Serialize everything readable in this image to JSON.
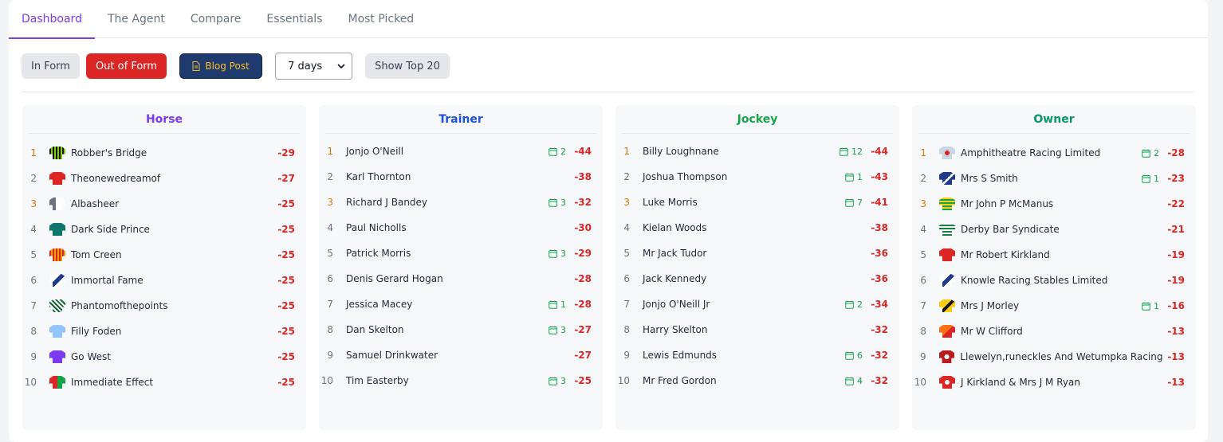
{
  "tabs": [
    "Dashboard",
    "The Agent",
    "Compare",
    "Essentials",
    "Most Picked"
  ],
  "toolbar": {
    "in_form": "In Form",
    "out_of_form": "Out of Form",
    "blog_post": "Blog Post",
    "days": "7 days",
    "show_top": "Show Top 20"
  },
  "colors": {
    "horse": "#7c3aed",
    "trainer": "#1d4ed8",
    "jockey": "#16a34a",
    "owner": "#059669",
    "negative": "#dc2626",
    "gold_rank": "#d97706"
  },
  "horse": {
    "title": "Horse",
    "rows": [
      {
        "rank": "1",
        "name": "Robber's Bridge",
        "value": "-29"
      },
      {
        "rank": "2",
        "name": "Theonewedreamof",
        "value": "-27"
      },
      {
        "rank": "3",
        "name": "Albasheer",
        "value": "-25"
      },
      {
        "rank": "4",
        "name": "Dark Side Prince",
        "value": "-25"
      },
      {
        "rank": "5",
        "name": "Tom Creen",
        "value": "-25"
      },
      {
        "rank": "6",
        "name": "Immortal Fame",
        "value": "-25"
      },
      {
        "rank": "7",
        "name": "Phantomofthepoints",
        "value": "-25"
      },
      {
        "rank": "8",
        "name": "Filly Foden",
        "value": "-25"
      },
      {
        "rank": "9",
        "name": "Go West",
        "value": "-25"
      },
      {
        "rank": "10",
        "name": "Immediate Effect",
        "value": "-25"
      }
    ]
  },
  "trainer": {
    "title": "Trainer",
    "rows": [
      {
        "rank": "1",
        "name": "Jonjo O'Neill",
        "count": "2",
        "value": "-44"
      },
      {
        "rank": "2",
        "name": "Karl Thornton",
        "count": "",
        "value": "-38"
      },
      {
        "rank": "3",
        "name": "Richard J Bandey",
        "count": "3",
        "value": "-32"
      },
      {
        "rank": "4",
        "name": "Paul Nicholls",
        "count": "",
        "value": "-30"
      },
      {
        "rank": "5",
        "name": "Patrick Morris",
        "count": "3",
        "value": "-29"
      },
      {
        "rank": "6",
        "name": "Denis Gerard Hogan",
        "count": "",
        "value": "-28"
      },
      {
        "rank": "7",
        "name": "Jessica Macey",
        "count": "1",
        "value": "-28"
      },
      {
        "rank": "8",
        "name": "Dan Skelton",
        "count": "3",
        "value": "-27"
      },
      {
        "rank": "9",
        "name": "Samuel Drinkwater",
        "count": "",
        "value": "-27"
      },
      {
        "rank": "10",
        "name": "Tim Easterby",
        "count": "3",
        "value": "-25"
      }
    ]
  },
  "jockey": {
    "title": "Jockey",
    "rows": [
      {
        "rank": "1",
        "name": "Billy Loughnane",
        "count": "12",
        "value": "-44"
      },
      {
        "rank": "2",
        "name": "Joshua Thompson",
        "count": "1",
        "value": "-43"
      },
      {
        "rank": "3",
        "name": "Luke Morris",
        "count": "7",
        "value": "-41"
      },
      {
        "rank": "4",
        "name": "Kielan Woods",
        "count": "",
        "value": "-38"
      },
      {
        "rank": "5",
        "name": "Mr Jack Tudor",
        "count": "",
        "value": "-36"
      },
      {
        "rank": "6",
        "name": "Jack Kennedy",
        "count": "",
        "value": "-36"
      },
      {
        "rank": "7",
        "name": "Jonjo O'Neill Jr",
        "count": "2",
        "value": "-34"
      },
      {
        "rank": "8",
        "name": "Harry Skelton",
        "count": "",
        "value": "-32"
      },
      {
        "rank": "9",
        "name": "Lewis Edmunds",
        "count": "6",
        "value": "-32"
      },
      {
        "rank": "10",
        "name": "Mr Fred Gordon",
        "count": "4",
        "value": "-32"
      }
    ]
  },
  "owner": {
    "title": "Owner",
    "rows": [
      {
        "rank": "1",
        "name": "Amphitheatre Racing Limited",
        "count": "2",
        "value": "-28"
      },
      {
        "rank": "2",
        "name": "Mrs S Smith",
        "count": "1",
        "value": "-23"
      },
      {
        "rank": "3",
        "name": "Mr John P McManus",
        "count": "",
        "value": "-22"
      },
      {
        "rank": "4",
        "name": "Derby Bar Syndicate",
        "count": "",
        "value": "-21"
      },
      {
        "rank": "5",
        "name": "Mr Robert Kirkland",
        "count": "",
        "value": "-19"
      },
      {
        "rank": "6",
        "name": "Knowle Racing Stables Limited",
        "count": "",
        "value": "-19"
      },
      {
        "rank": "7",
        "name": "Mrs J Morley",
        "count": "1",
        "value": "-16"
      },
      {
        "rank": "8",
        "name": "Mr W Clifford",
        "count": "",
        "value": "-13"
      },
      {
        "rank": "9",
        "name": "Llewelyn,runeckles And Wetumpka Racing",
        "count": "",
        "value": "-13"
      },
      {
        "rank": "10",
        "name": "J Kirkland & Mrs J M Ryan",
        "count": "",
        "value": "-13"
      }
    ]
  }
}
